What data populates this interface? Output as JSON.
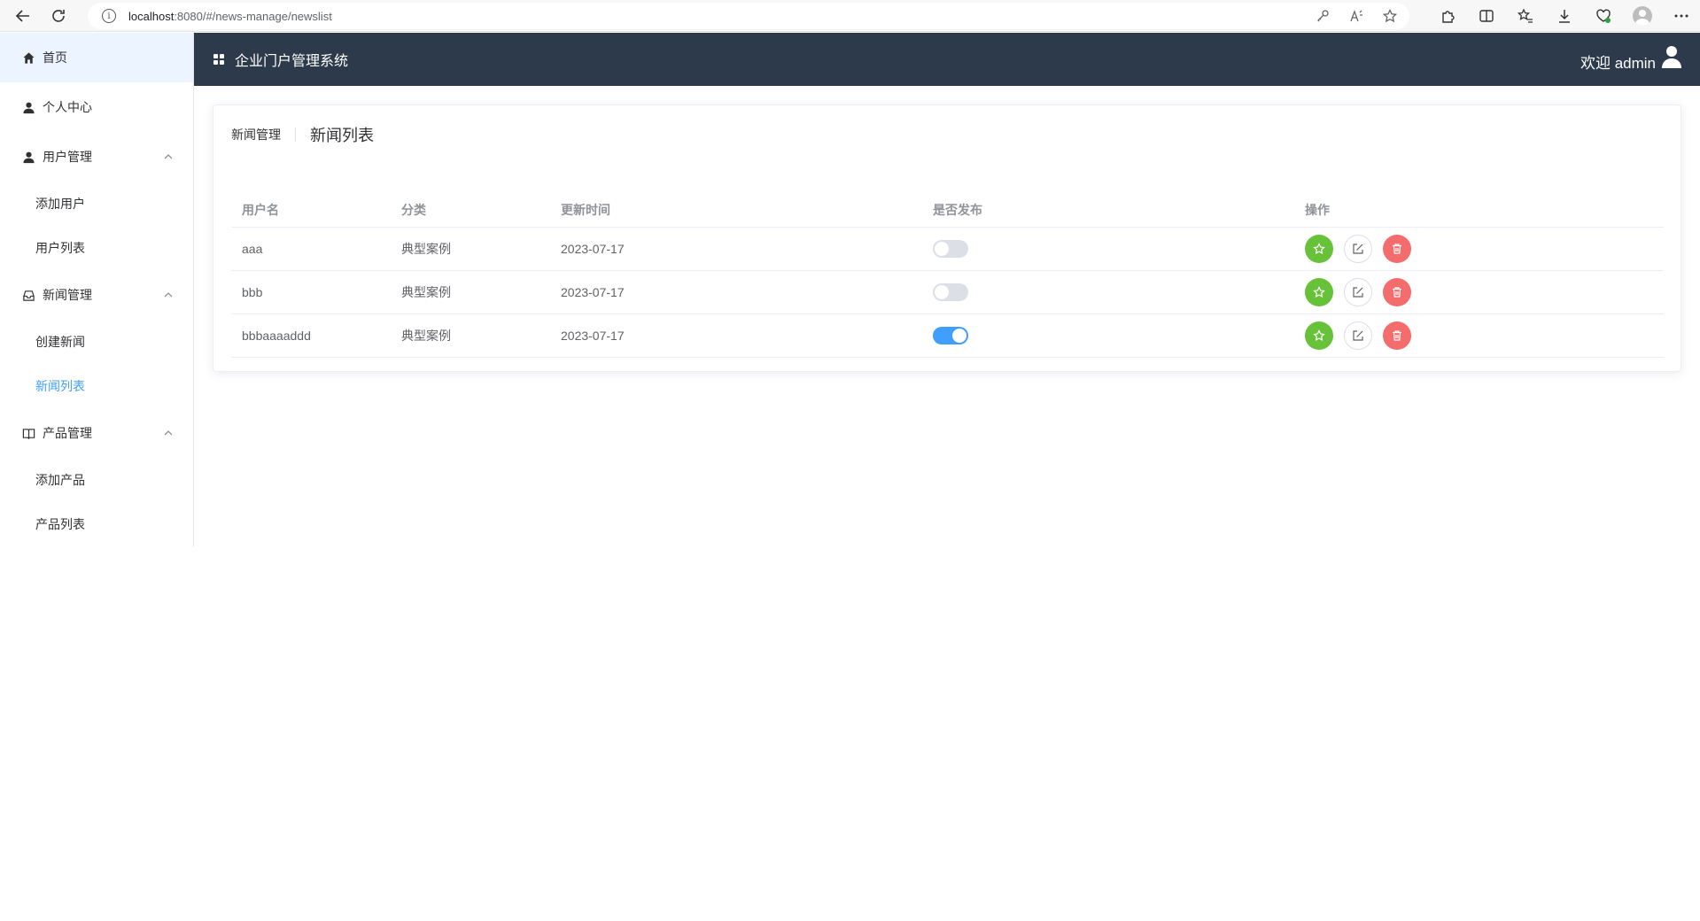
{
  "browser": {
    "url_host": "localhost",
    "url_path": ":8080/#/news-manage/newslist"
  },
  "header": {
    "title": "企业门户管理系统",
    "welcome": "欢迎 admin"
  },
  "sidebar": {
    "home": "首页",
    "profile": "个人中心",
    "user_mgmt": "用户管理",
    "add_user": "添加用户",
    "user_list": "用户列表",
    "news_mgmt": "新闻管理",
    "create_news": "创建新闻",
    "news_list": "新闻列表",
    "product_mgmt": "产品管理",
    "add_product": "添加产品",
    "product_list": "产品列表"
  },
  "page_header": {
    "back": "新闻管理",
    "content": "新闻列表"
  },
  "table": {
    "columns": [
      "用户名",
      "分类",
      "更新时间",
      "是否发布",
      "操作"
    ],
    "rows": [
      {
        "username": "aaa",
        "category": "典型案例",
        "updated": "2023-07-17",
        "published": false
      },
      {
        "username": "bbb",
        "category": "典型案例",
        "updated": "2023-07-17",
        "published": false
      },
      {
        "username": "bbbaaaaddd",
        "category": "典型案例",
        "updated": "2023-07-17",
        "published": true
      }
    ]
  },
  "colors": {
    "header_bg": "#2d3a4b",
    "accent": "#409eff",
    "success": "#67c23a",
    "danger": "#f56c6c"
  }
}
